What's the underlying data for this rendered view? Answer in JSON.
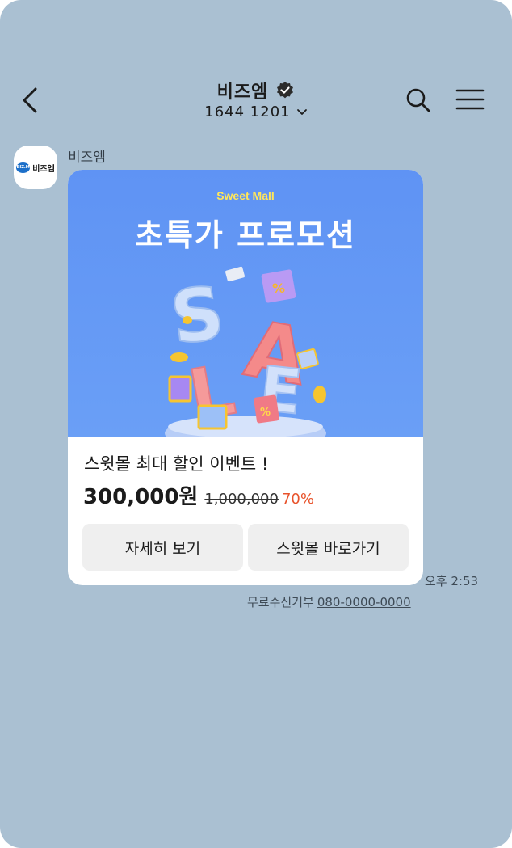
{
  "header": {
    "title": "비즈엠",
    "phone": "1644  1201",
    "icons": [
      "back-arrow-icon",
      "verified-badge-icon",
      "chevron-down-icon",
      "search-icon",
      "menu-icon"
    ]
  },
  "message": {
    "sender": "비즈엠",
    "avatar_logo_text": "비즈엠",
    "avatar_badge_text": "BIZ.M",
    "banner_subtitle": "Sweet Mall",
    "banner_title": "초특가 프로모션",
    "banner_art_letters": [
      "S",
      "A",
      "L",
      "E"
    ],
    "product_title": "스윗몰 최대 할인 이벤트 !",
    "price": "300,000원",
    "original_price": "1,000,000",
    "discount": "70%",
    "buttons": {
      "detail": "자세히 보기",
      "go": "스윗몰 바로가기"
    },
    "time": "오후 2:53",
    "optout_label": "무료수신거부",
    "optout_number": "080-0000-0000"
  },
  "colors": {
    "background": "#aac0d2",
    "banner": "#6a9ff6",
    "accent_discount": "#e8532b",
    "banner_subtitle": "#ffe65a"
  }
}
